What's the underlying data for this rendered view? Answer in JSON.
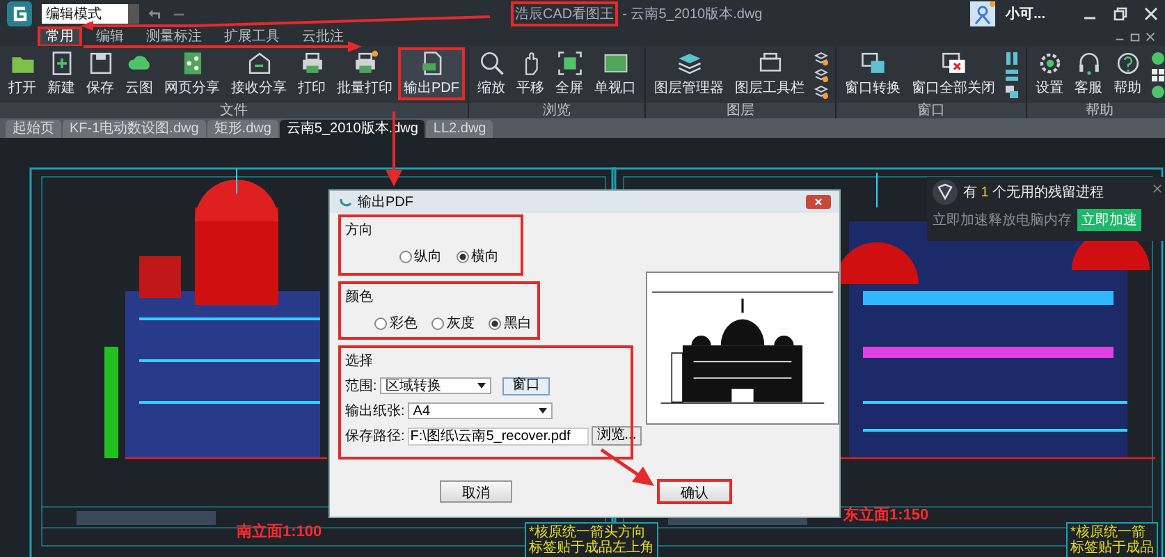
{
  "window": {
    "mode_field": {
      "value": "编辑模式"
    },
    "title_app": {
      "text": "浩辰CAD看图王",
      "highlighted": true
    },
    "title_file": "- 云南5_2010版本.dwg",
    "user_name": "小可..."
  },
  "menu_tabs": [
    {
      "label": "常用",
      "selected": true,
      "highlighted": true
    },
    {
      "label": "编辑",
      "selected": false,
      "highlighted": false
    },
    {
      "label": "测量标注",
      "selected": false,
      "highlighted": false
    },
    {
      "label": "扩展工具",
      "selected": false,
      "highlighted": false
    },
    {
      "label": "云批注",
      "selected": false,
      "highlighted": false
    }
  ],
  "ribbon": [
    {
      "label": "文件",
      "items": [
        {
          "label": "打开",
          "highlighted": false
        },
        {
          "label": "新建",
          "highlighted": false
        },
        {
          "label": "保存",
          "highlighted": false
        },
        {
          "label": "云图",
          "highlighted": false
        },
        {
          "label": "网页分享",
          "highlighted": false
        },
        {
          "label": "接收分享",
          "highlighted": false
        },
        {
          "label": "打印",
          "highlighted": false
        },
        {
          "label": "批量打印",
          "highlighted": false
        },
        {
          "label": "输出PDF",
          "highlighted": true
        }
      ]
    },
    {
      "label": "浏览",
      "items": [
        {
          "label": "缩放",
          "highlighted": false
        },
        {
          "label": "平移",
          "highlighted": false
        },
        {
          "label": "全屏",
          "highlighted": false
        },
        {
          "label": "单视口",
          "highlighted": false
        }
      ]
    },
    {
      "label": "图层",
      "items": [
        {
          "label": "图层管理器",
          "highlighted": false
        },
        {
          "label": "图层工具栏",
          "highlighted": false
        }
      ]
    },
    {
      "label": "窗口",
      "items": [
        {
          "label": "窗口转换",
          "highlighted": false
        },
        {
          "label": "窗口全部关闭",
          "highlighted": false
        }
      ]
    },
    {
      "label": "帮助",
      "items": [
        {
          "label": "设置",
          "highlighted": false
        },
        {
          "label": "客服",
          "highlighted": false
        },
        {
          "label": "帮助",
          "highlighted": false
        }
      ]
    }
  ],
  "doc_tabs": [
    {
      "label": "起始页",
      "selected": false
    },
    {
      "label": "KF-1电动数设图.dwg",
      "selected": false
    },
    {
      "label": "矩形.dwg",
      "selected": false
    },
    {
      "label": "云南5_2010版本.dwg",
      "selected": true
    },
    {
      "label": "LL2.dwg",
      "selected": false
    }
  ],
  "drawing": {
    "labels": [
      {
        "text": "南立面1:100"
      },
      {
        "text": "东立面1:150"
      }
    ],
    "notes": [
      {
        "line_1": "*核原统一箭头方向",
        "line_2": "标签贴于成品左上角"
      },
      {
        "line_1": "*核原统一箭",
        "line_2": "标签贴于成品"
      }
    ]
  },
  "notification": {
    "prefix": "有",
    "count": "1",
    "suffix": "个无用的残留进程",
    "message": "立即加速释放电脑内存",
    "button": "立即加速"
  },
  "dialog": {
    "title": "输出PDF",
    "orientation": {
      "title": "方向",
      "highlighted": true,
      "options": [
        {
          "label": "纵向",
          "selected": false
        },
        {
          "label": "横向",
          "selected": true
        }
      ]
    },
    "color": {
      "title": "颜色",
      "highlighted": true,
      "options": [
        {
          "label": "彩色",
          "selected": false
        },
        {
          "label": "灰度",
          "selected": false
        },
        {
          "label": "黑白",
          "selected": true
        }
      ]
    },
    "selection": {
      "title": "选择",
      "highlighted": true,
      "range_label": "范围:",
      "range_value": "区域转换",
      "window_button": "窗口",
      "paper_label": "输出纸张:",
      "paper_value": "A4",
      "path_label": "保存路径:",
      "path_value": "F:\\图纸\\云南5_recover.pdf",
      "browse_button": "浏览..."
    },
    "buttons": [
      {
        "label": "取消",
        "highlighted": false
      },
      {
        "label": "确认",
        "highlighted": true
      }
    ]
  }
}
